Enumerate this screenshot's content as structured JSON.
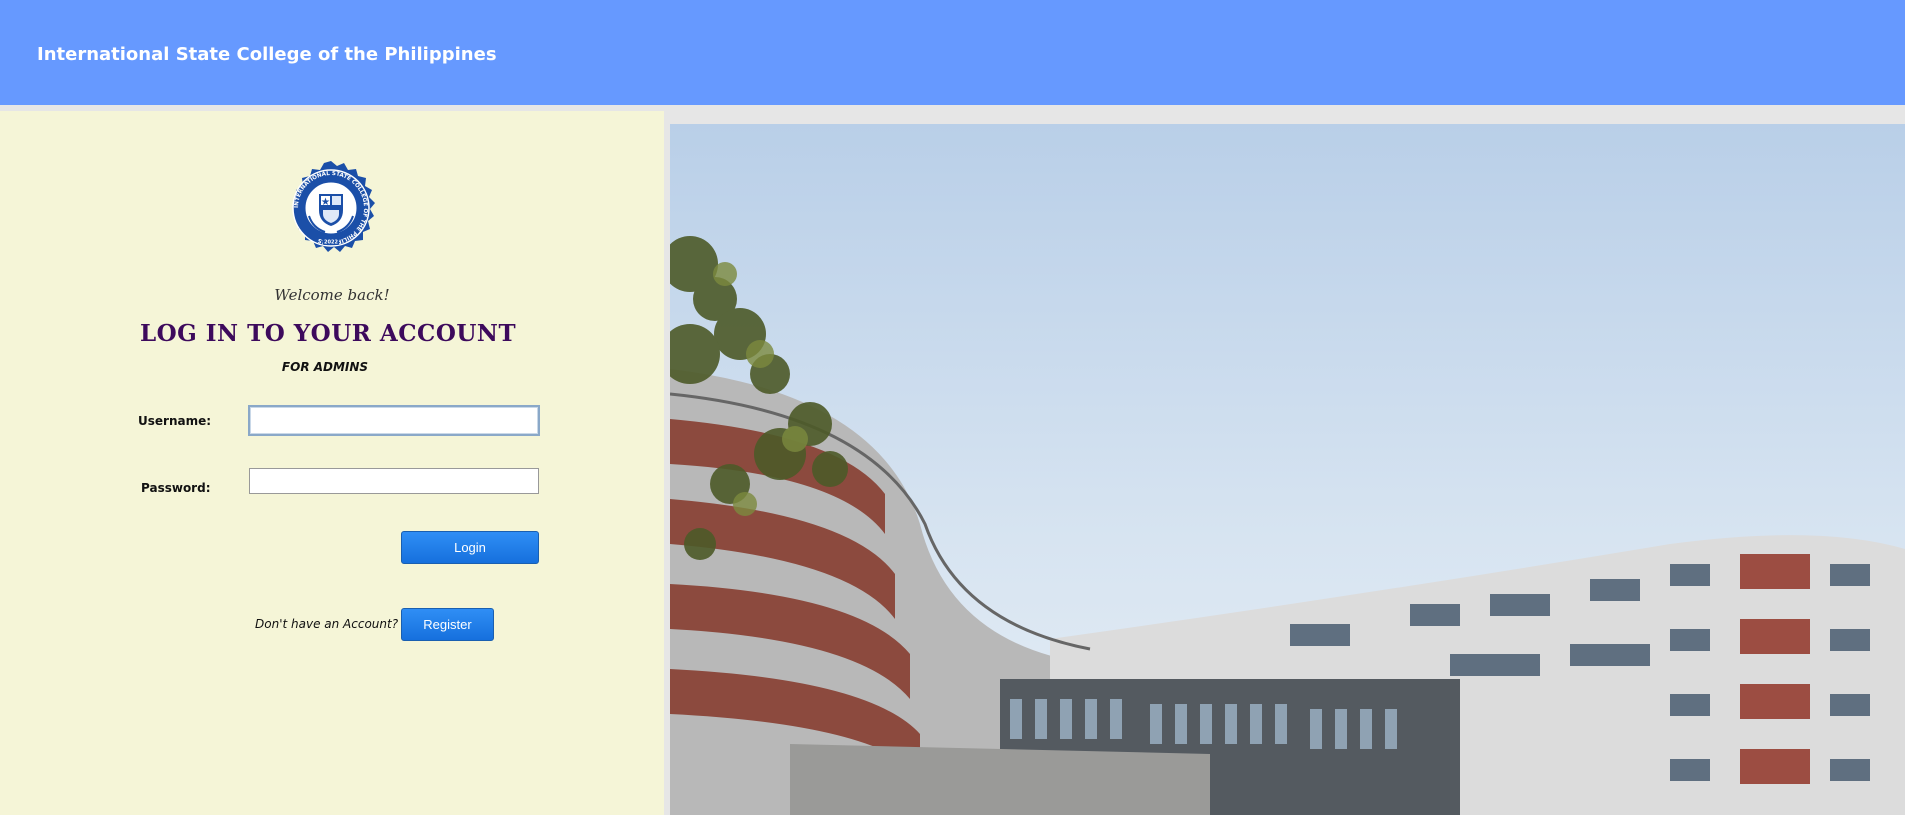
{
  "header": {
    "title": "International State College of the Philippines",
    "color": "#6699ff"
  },
  "login": {
    "logo_icon": "college-seal",
    "welcome": "Welcome back!",
    "title": "LOG IN TO YOUR ACCOUNT",
    "subtitle": "FOR ADMINS",
    "username_label": "Username:",
    "password_label": "Password:",
    "login_button": "Login",
    "no_account_text": "Don't have an Account?",
    "register_button": "Register",
    "panel_color": "#f5f5d7",
    "title_color": "#3d0a5c",
    "button_color": "#1e7ee8"
  },
  "seal": {
    "ring_text": "INTERNATIONAL STATE COLLEGE OF THE PHILIPPINES",
    "year": "2022"
  }
}
